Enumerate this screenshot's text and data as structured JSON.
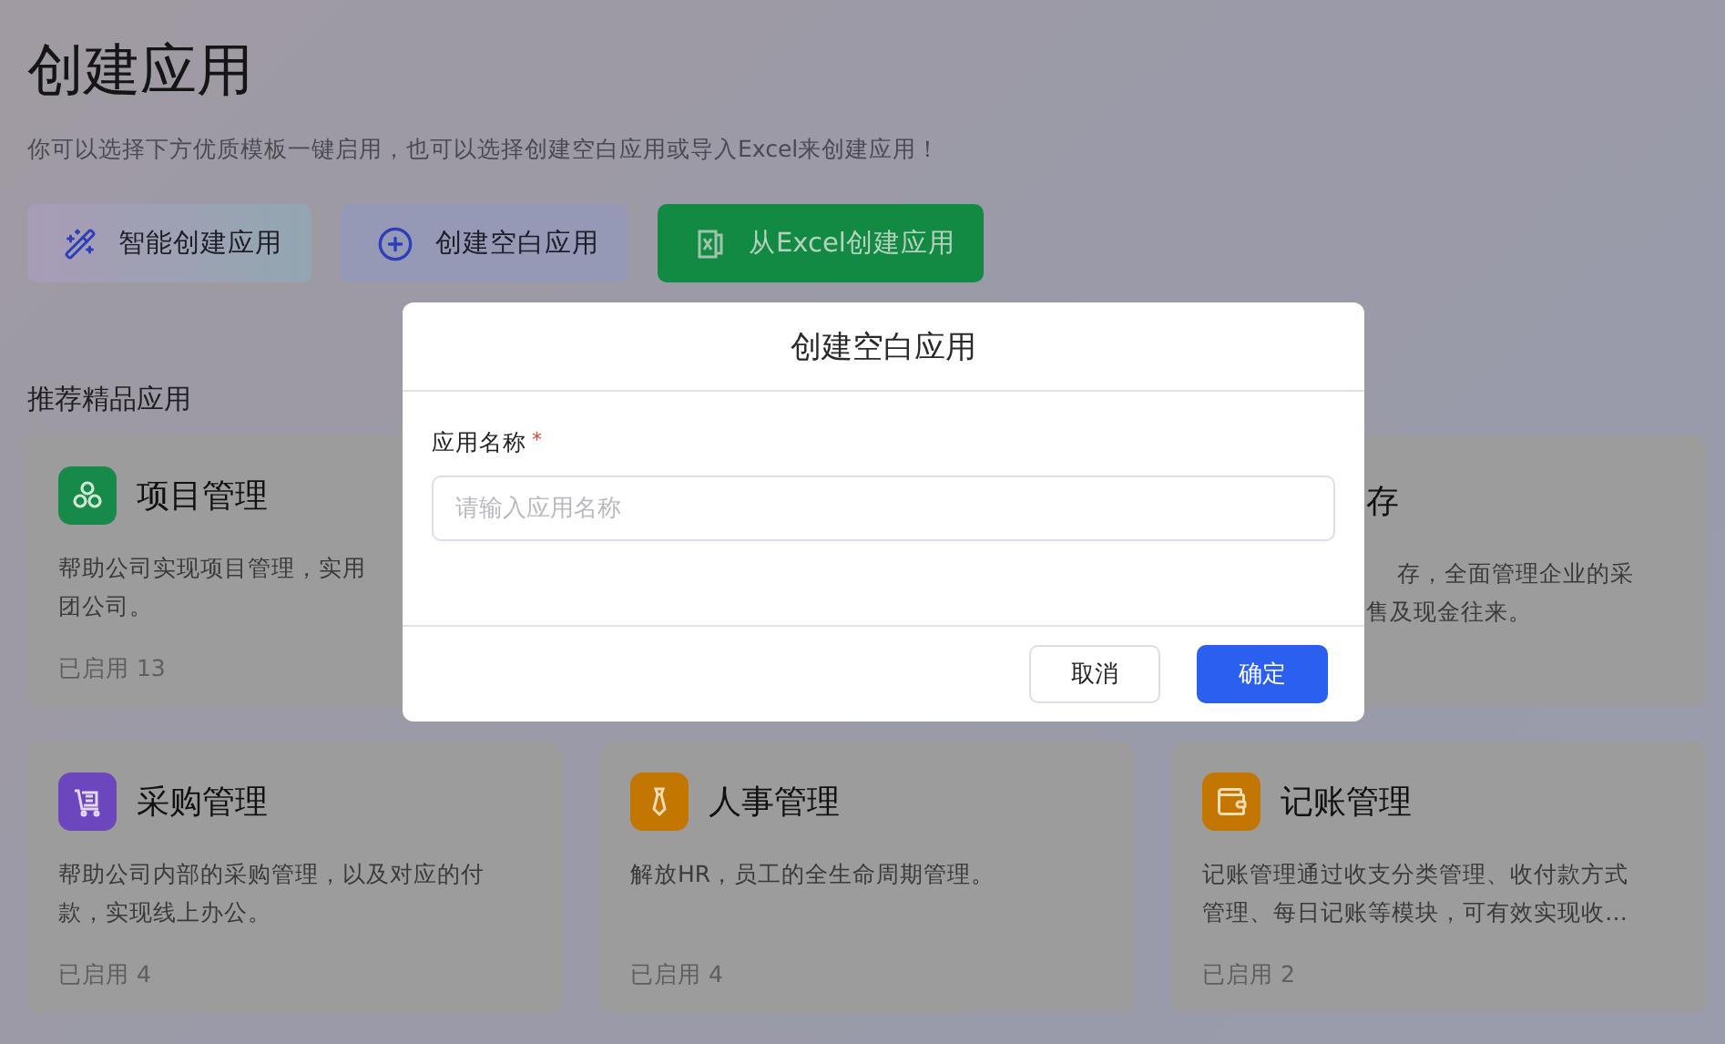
{
  "page": {
    "title": "创建应用",
    "subtitle": "你可以选择下方优质模板一键启用，也可以选择创建空白应用或导入Excel来创建应用！"
  },
  "actions": [
    {
      "kind": "ai",
      "label": "智能创建应用"
    },
    {
      "kind": "blank",
      "label": "创建空白应用"
    },
    {
      "kind": "excel",
      "label": "从Excel创建应用"
    }
  ],
  "section_title": "推荐精品应用",
  "apps": [
    {
      "kind": "project",
      "name": "项目管理",
      "description": [
        "帮助公司实现项目管理，实用",
        "团公司。"
      ],
      "usage": "已启用 13",
      "color": "#178a48"
    },
    {
      "kind": "covered",
      "name": "存",
      "description": [
        "存，全面管理企业的采",
        "售及现金往来。"
      ]
    },
    {
      "kind": "cart",
      "name": "采购管理",
      "description": [
        "帮助公司内部的采购管理，以及对应的付",
        "款，实现线上办公。"
      ],
      "usage": "已启用 4",
      "color": "#6c46bd"
    },
    {
      "kind": "tie",
      "name": "人事管理",
      "description": [
        "解放HR，员工的全生命周期管理。"
      ],
      "usage": "已启用 4",
      "color": "#c47700"
    },
    {
      "kind": "wallet",
      "name": "记账管理",
      "description": [
        "记账管理通过收支分类管理、收付款方式",
        "管理、每日记账等模块，可有效实现收…"
      ],
      "usage": "已启用 2",
      "color": "#c47700"
    }
  ],
  "dialog": {
    "title": "创建空白应用",
    "field": {
      "label": "应用名称",
      "required_mark": "*",
      "placeholder": "请输入应用名称"
    },
    "buttons": [
      {
        "kind": "secondary",
        "label": "取消"
      },
      {
        "kind": "primary",
        "label": "确定"
      }
    ]
  }
}
